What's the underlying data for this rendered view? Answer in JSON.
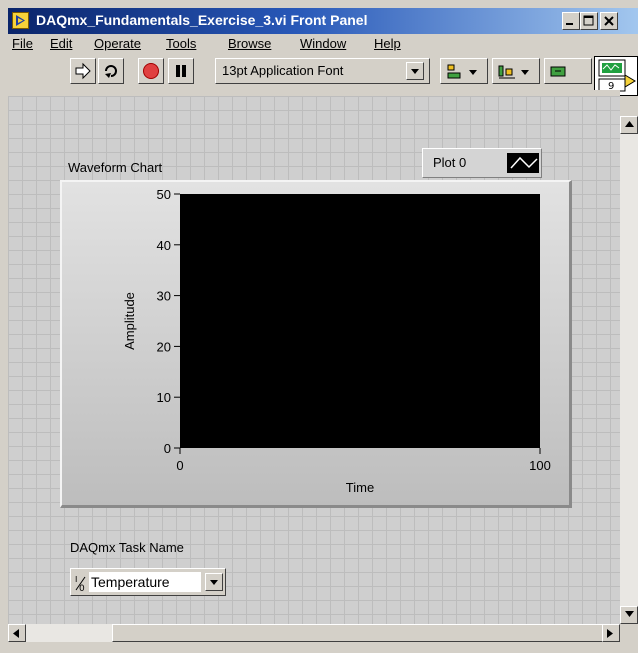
{
  "window": {
    "title": "DAQmx_Fundamentals_Exercise_3.vi Front Panel"
  },
  "menu": [
    {
      "name": "file",
      "label": "File"
    },
    {
      "name": "edit",
      "label": "Edit"
    },
    {
      "name": "operate",
      "label": "Operate"
    },
    {
      "name": "tools",
      "label": "Tools"
    },
    {
      "name": "browse",
      "label": "Browse"
    },
    {
      "name": "window",
      "label": "Window"
    },
    {
      "name": "help",
      "label": "Help"
    }
  ],
  "toolbar": {
    "font_label": "13pt Application Font",
    "icons": [
      "run-arrow-icon",
      "run-continuously-icon",
      "abort-icon",
      "pause-icon",
      "align-objects-icon",
      "distribute-objects-icon",
      "reorder-icon"
    ]
  },
  "vi_icon": {
    "number": "9"
  },
  "chart": {
    "label": "Waveform Chart",
    "legend_plot_name": "Plot 0",
    "colors": {
      "plot_area": "#000000",
      "frame": "#cfcfcf"
    }
  },
  "chart_data": {
    "type": "line",
    "title": "Waveform Chart",
    "xlabel": "Time",
    "ylabel": "Amplitude",
    "xlim": [
      0,
      100
    ],
    "ylim": [
      0,
      50
    ],
    "xticks": [
      "0",
      "100"
    ],
    "yticks": [
      "0",
      "10",
      "20",
      "30",
      "40",
      "50"
    ],
    "series": [
      {
        "name": "Plot 0",
        "values": []
      }
    ],
    "grid": false,
    "legend_placement": "top-right"
  },
  "task": {
    "label": "DAQmx Task Name",
    "value": "Temperature"
  }
}
